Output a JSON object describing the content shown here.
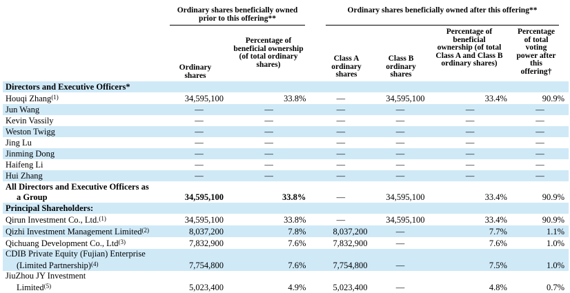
{
  "header": {
    "group_prior": "Ordinary shares beneficially owned prior to this offering**",
    "group_after": "Ordinary shares beneficially owned after this offering**",
    "columns": [
      "Ordinary shares",
      "Percentage of beneficial ownership (of total ordinary shares)",
      "Class A ordinary shares",
      "Class B ordinary shares",
      "Percentage of beneficial ownership (of total Class A and Class B ordinary shares)",
      "Percentage of total voting power after this offering†"
    ]
  },
  "sections": {
    "directors": "Directors and Executive Officers*",
    "principal": "Principal Shareholders:"
  },
  "rows": [
    {
      "name": "Houqi Zhang",
      "fn": "(1)",
      "c1": "34,595,100",
      "c2": "33.8%",
      "c3": "—",
      "c4": "34,595,100",
      "c5": "33.4%",
      "c6": "90.9%"
    },
    {
      "name": "Jun Wang",
      "c1": "—",
      "c2": "—",
      "c3": "—",
      "c4": "—",
      "c5": "—",
      "c6": "—"
    },
    {
      "name": "Kevin Vassily",
      "c1": "—",
      "c2": "—",
      "c3": "—",
      "c4": "—",
      "c5": "—",
      "c6": "—"
    },
    {
      "name": "Weston Twigg",
      "c1": "—",
      "c2": "—",
      "c3": "—",
      "c4": "—",
      "c5": "—",
      "c6": "—"
    },
    {
      "name": "Jing Lu",
      "c1": "—",
      "c2": "—",
      "c3": "—",
      "c4": "—",
      "c5": "—",
      "c6": "—"
    },
    {
      "name": "Jinming Dong",
      "c1": "—",
      "c2": "—",
      "c3": "—",
      "c4": "—",
      "c5": "—",
      "c6": "—"
    },
    {
      "name": "Haifeng Li",
      "c1": "—",
      "c2": "—",
      "c3": "—",
      "c4": "—",
      "c5": "—",
      "c6": "—"
    },
    {
      "name": "Hui Zhang",
      "c1": "—",
      "c2": "—",
      "c3": "—",
      "c4": "—",
      "c5": "—",
      "c6": "—"
    }
  ],
  "group_row": {
    "line1": "All Directors and Executive Officers as",
    "line2": "a Group",
    "c1": "34,595,100",
    "c2": "33.8%",
    "c3": "—",
    "c4": "34,595,100",
    "c5": "33.4%",
    "c6": "90.9%"
  },
  "principal_rows": [
    {
      "name": "Qirun Investment Co., Ltd.",
      "fn": "(1)",
      "c1": "34,595,100",
      "c2": "33.8%",
      "c3": "—",
      "c4": "34,595,100",
      "c5": "33.4%",
      "c6": "90.9%"
    },
    {
      "name": "Qizhi Investment Management Limited",
      "fn": "(2)",
      "c1": "8,037,200",
      "c2": "7.8%",
      "c3": "8,037,200",
      "c4": "—",
      "c5": "7.7%",
      "c6": "1.1%"
    },
    {
      "name": "Qichuang Development Co., Ltd",
      "fn": "(3)",
      "c1": "7,832,900",
      "c2": "7.6%",
      "c3": "7,832,900",
      "c4": "—",
      "c5": "7.6%",
      "c6": "1.0%"
    },
    {
      "line1": "CDIB Private Equity (Fujian) Enterprise",
      "line2": "(Limited Partnership)",
      "fn": "(4)",
      "c1": "7,754,800",
      "c2": "7.6%",
      "c3": "7,754,800",
      "c4": "—",
      "c5": "7.5%",
      "c6": "1.0%"
    },
    {
      "line1": "JiuZhou JY Investment",
      "line2": "Limited",
      "fn": "(5)",
      "c1": "5,023,400",
      "c2": "4.9%",
      "c3": "5,023,400",
      "c4": "—",
      "c5": "4.8%",
      "c6": "0.7%"
    }
  ]
}
